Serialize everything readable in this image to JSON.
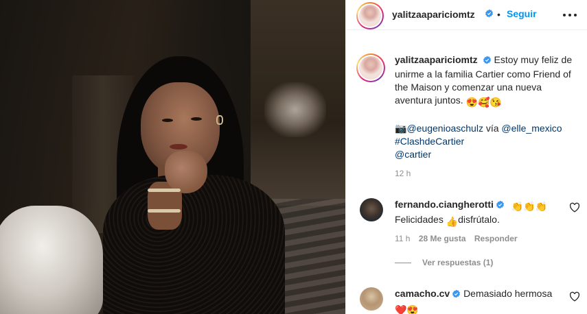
{
  "post": {
    "username": "yalitzaapariciomtz",
    "follow_label": "Seguir",
    "follow_separator": "•",
    "caption_text": "Estoy muy feliz de unirme a la familia Cartier como Friend of the Maison y comenzar una nueva aventura juntos.",
    "caption_emojis": "😍🥰😘",
    "credit_camera_emoji": "📷",
    "credit_user": "@eugenioaschulz",
    "credit_via": " vía ",
    "credit_source": "@elle_mexico",
    "hashtag": "#ClashdeCartier",
    "mention": "@cartier",
    "time_ago": "12 h"
  },
  "comments": [
    {
      "username": "fernando.ciangherotti",
      "verified": true,
      "text_before": "Felicidades ",
      "emoji_mid": "👍",
      "text_after": "disfrútalo. ",
      "emoji_end": "👏👏👏",
      "time": "11 h",
      "likes": "28 Me gusta",
      "reply_label": "Responder"
    },
    {
      "username": "camacho.cv",
      "verified": true,
      "text": "Demasiado hermosa ",
      "emoji_end": "❤️😍"
    }
  ],
  "view_replies_label": "Ver respuestas (1)",
  "colors": {
    "verified": "#3897f0",
    "link": "#00376b",
    "follow": "#0095f6",
    "muted": "#8e8e8e"
  },
  "icons": [
    "verified-badge-icon",
    "more-options-icon",
    "heart-icon"
  ]
}
